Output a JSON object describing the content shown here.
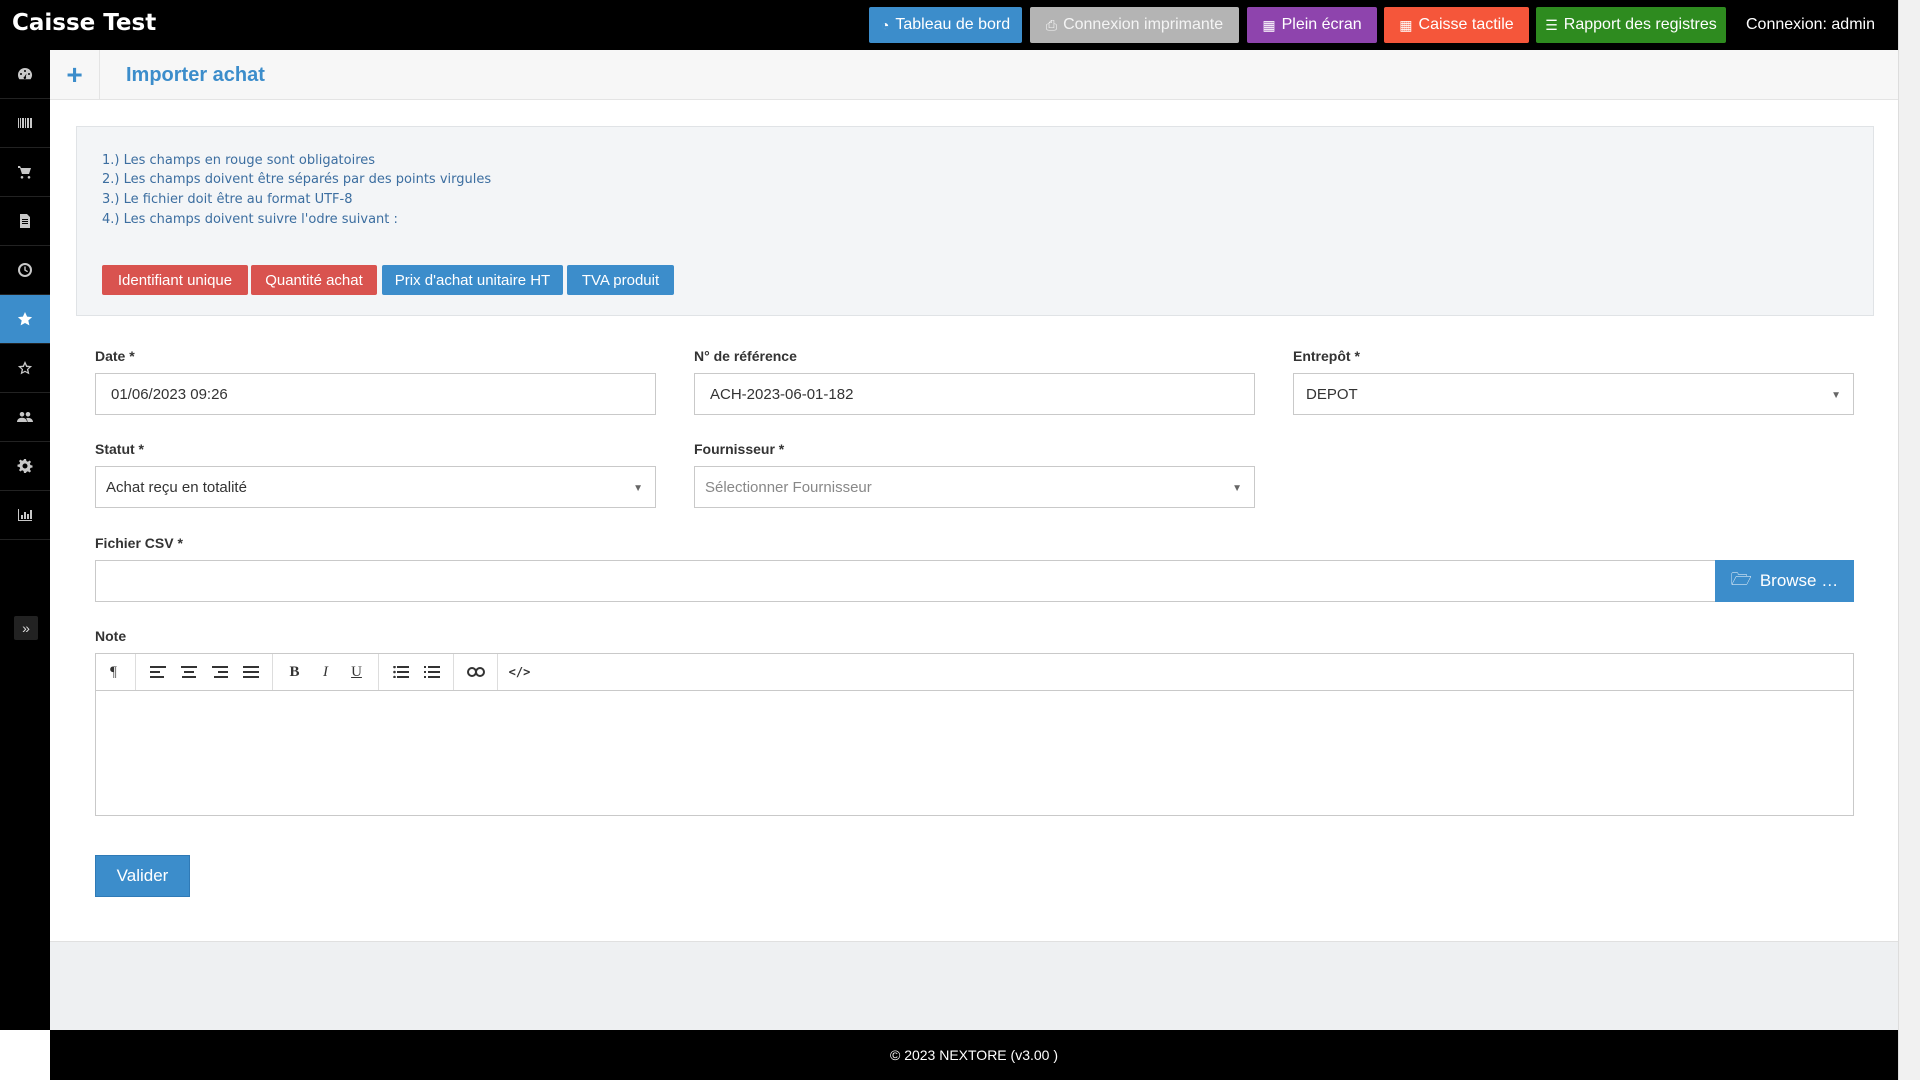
{
  "app": {
    "title": "Caisse Test",
    "login": "Connexion: admin"
  },
  "topbar": {
    "dashboard": "Tableau de bord",
    "printer": "Connexion imprimante",
    "fullscreen": "Plein écran",
    "touch": "Caisse tactile",
    "report": "Rapport des registres"
  },
  "page": {
    "title": "Importer achat"
  },
  "info": {
    "lines": [
      "1.) Les champs en rouge sont obligatoires",
      "2.) Les champs doivent être séparés par des points virgules",
      "3.) Le fichier doit être au format UTF-8",
      "4.) Les champs doivent suivre l'odre suivant :"
    ],
    "tags": [
      {
        "label": "Identifiant unique",
        "color": "#d9534f"
      },
      {
        "label": "Quantité achat",
        "color": "#d9534f"
      },
      {
        "label": "Prix d'achat unitaire HT",
        "color": "#3c8dcb"
      },
      {
        "label": "TVA produit",
        "color": "#3c8dcb"
      }
    ]
  },
  "form": {
    "date_label": "Date *",
    "date_value": "01/06/2023 09:26",
    "ref_label": "N° de référence",
    "ref_value": "ACH-2023-06-01-182",
    "warehouse_label": "Entrepôt *",
    "warehouse_value": "DEPOT",
    "status_label": "Statut *",
    "status_value": "Achat reçu en totalité",
    "supplier_label": "Fournisseur *",
    "supplier_placeholder": "Sélectionner Fournisseur",
    "csv_label": "Fichier CSV *",
    "browse_label": "Browse …",
    "note_label": "Note",
    "submit_label": "Valider"
  },
  "footer": {
    "text": "© 2023 NEXTORE (v3.00 )"
  },
  "sidebar": {
    "items": [
      "dashboard-icon",
      "barcode-icon",
      "cart-icon",
      "document-icon",
      "clock-icon",
      "star-icon",
      "star-outline-icon",
      "users-icon",
      "gear-icon",
      "chart-icon"
    ],
    "active_index": 5
  },
  "colors": {
    "accent": "#3c8dcb",
    "danger": "#d9534f",
    "topbar": "#000000"
  }
}
